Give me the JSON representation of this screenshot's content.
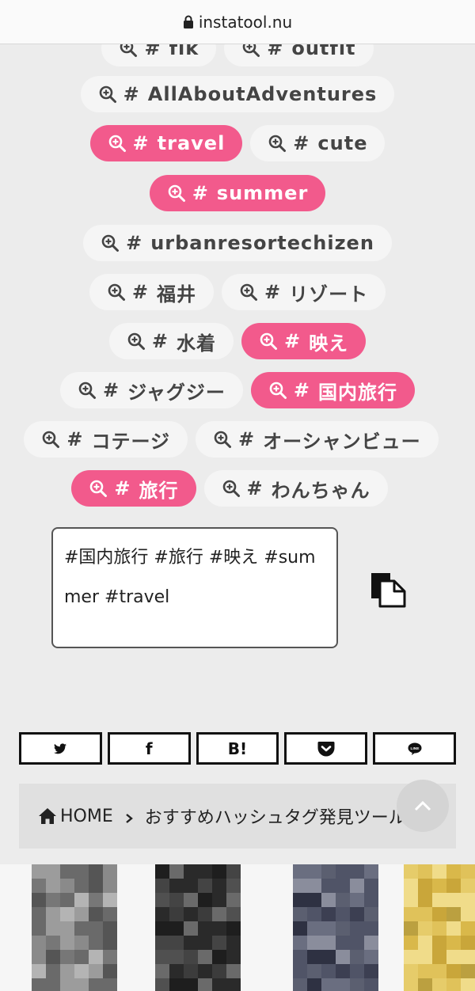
{
  "browser": {
    "url": "instatool.nu"
  },
  "tags": {
    "rows": [
      [
        {
          "label": "fik",
          "selected": false
        },
        {
          "label": "outfit",
          "selected": false
        }
      ],
      [
        {
          "label": "AllAboutAdventures",
          "selected": false
        }
      ],
      [
        {
          "label": "travel",
          "selected": true
        },
        {
          "label": "cute",
          "selected": false
        }
      ],
      [
        {
          "label": "summer",
          "selected": true
        }
      ],
      [
        {
          "label": "urbanresortechizen",
          "selected": false
        }
      ],
      [
        {
          "label": "福井",
          "selected": false
        },
        {
          "label": "リゾート",
          "selected": false
        }
      ],
      [
        {
          "label": "水着",
          "selected": false
        },
        {
          "label": "映え",
          "selected": true
        }
      ],
      [
        {
          "label": "ジャグジー",
          "selected": false
        },
        {
          "label": "国内旅行",
          "selected": true
        }
      ],
      [
        {
          "label": "コテージ",
          "selected": false
        },
        {
          "label": "オーシャンビュー",
          "selected": false
        }
      ],
      [
        {
          "label": "旅行",
          "selected": true
        },
        {
          "label": "わんちゃん",
          "selected": false
        }
      ]
    ]
  },
  "output": {
    "text": "#国内旅行 #旅行 #映え #summer #travel"
  },
  "share": [
    {
      "label": "",
      "icon": "twitter-icon"
    },
    {
      "label": "f",
      "icon": "facebook-icon"
    },
    {
      "label": "B!",
      "icon": "hatena-icon"
    },
    {
      "label": "",
      "icon": "pocket-icon"
    },
    {
      "label": "LINE",
      "icon": "line-icon"
    }
  ],
  "breadcrumb": {
    "home": "HOME",
    "current": "おすすめハッシュタグ発見ツール"
  },
  "colors": {
    "accent": "#f25a8c",
    "tag_bg": "#f5f5f5",
    "page_bg": "#ececec"
  }
}
